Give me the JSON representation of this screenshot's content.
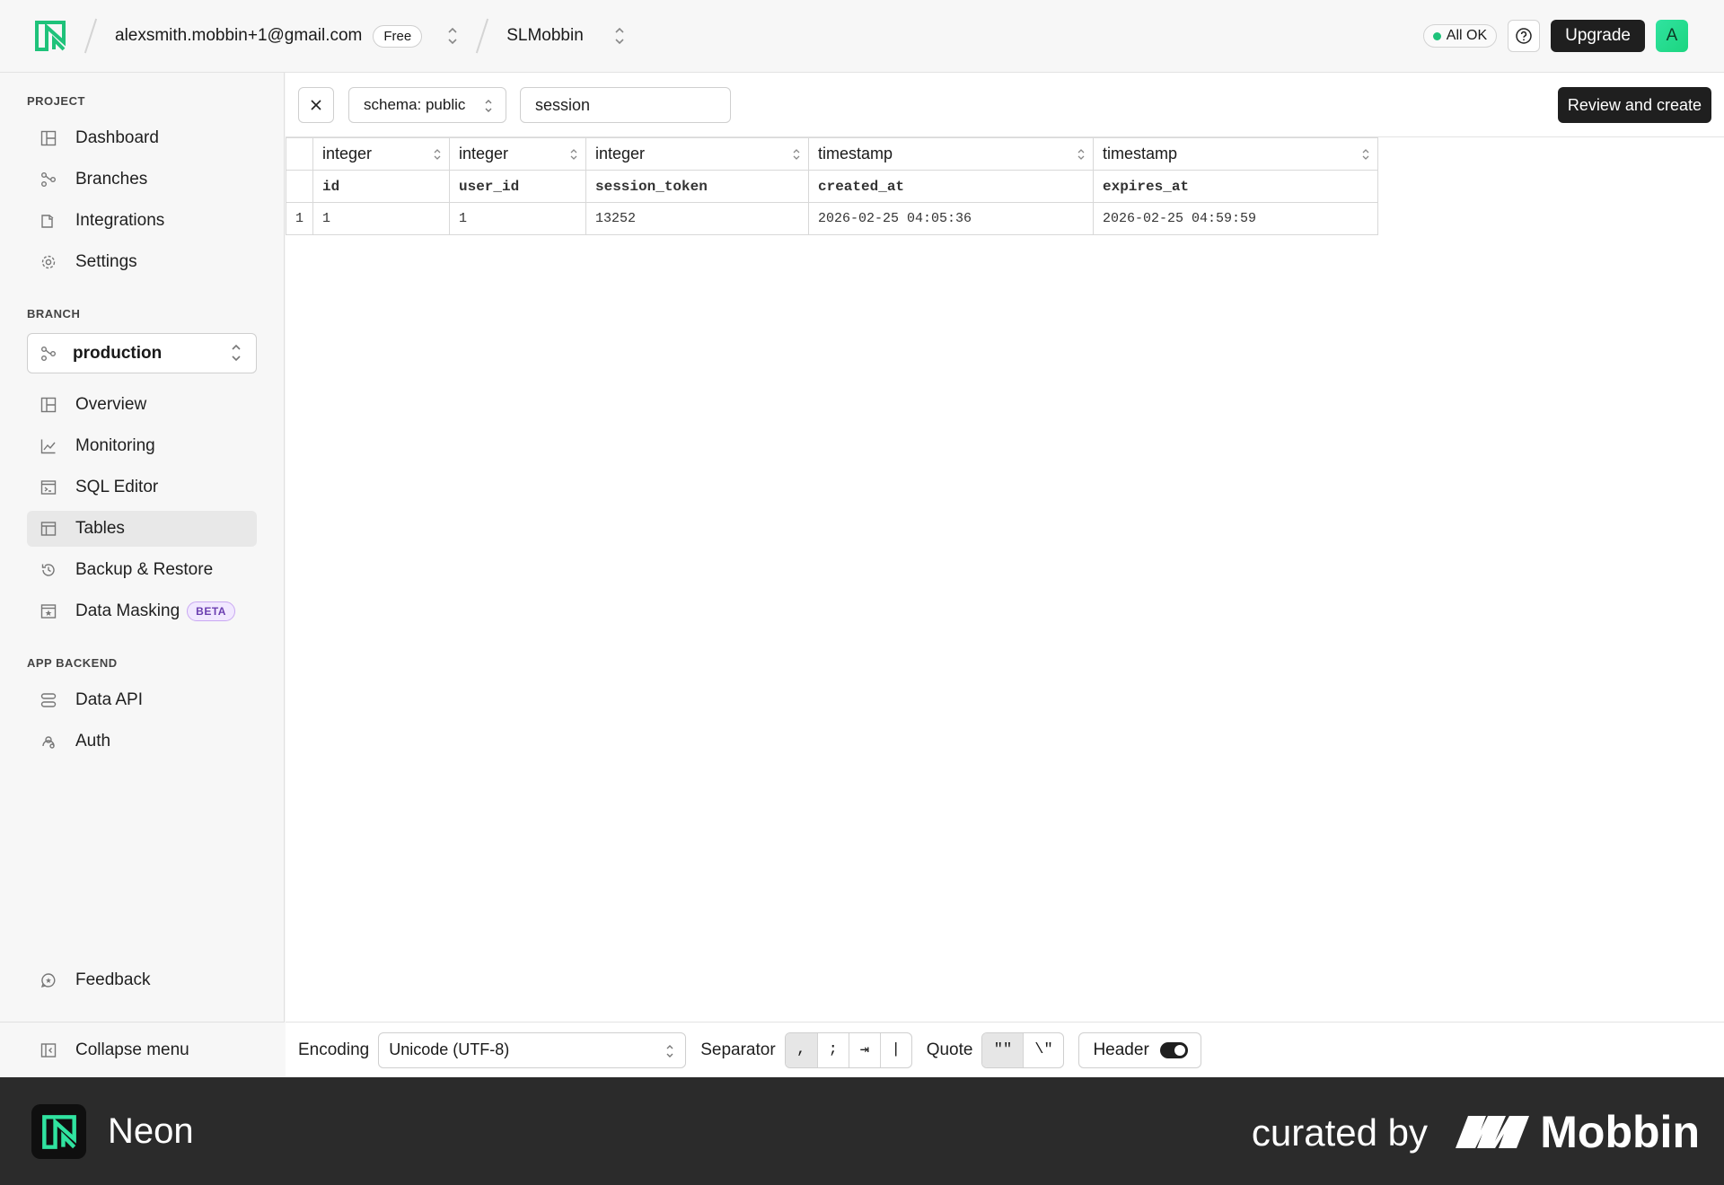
{
  "header": {
    "account": "alexsmith.mobbin+1@gmail.com",
    "plan_badge": "Free",
    "project": "SLMobbin",
    "status": "All OK",
    "upgrade_label": "Upgrade",
    "avatar_letter": "A"
  },
  "sidebar": {
    "project_title": "PROJECT",
    "project_items": [
      {
        "label": "Dashboard",
        "icon": "dashboard-icon"
      },
      {
        "label": "Branches",
        "icon": "branches-icon"
      },
      {
        "label": "Integrations",
        "icon": "integrations-icon"
      },
      {
        "label": "Settings",
        "icon": "gear-icon"
      }
    ],
    "branch_title": "BRANCH",
    "branch_selected": "production",
    "branch_items": [
      {
        "label": "Overview",
        "icon": "overview-icon"
      },
      {
        "label": "Monitoring",
        "icon": "chart-icon"
      },
      {
        "label": "SQL Editor",
        "icon": "terminal-icon"
      },
      {
        "label": "Tables",
        "icon": "table-icon",
        "active": true
      },
      {
        "label": "Backup & Restore",
        "icon": "history-icon"
      },
      {
        "label": "Data Masking",
        "icon": "mask-icon",
        "badge": "BETA"
      }
    ],
    "backend_title": "APP BACKEND",
    "backend_items": [
      {
        "label": "Data API",
        "icon": "api-icon"
      },
      {
        "label": "Auth",
        "icon": "auth-icon"
      }
    ],
    "feedback_label": "Feedback",
    "collapse_label": "Collapse menu"
  },
  "toolbar": {
    "schema_label": "schema: public",
    "table_name": "session",
    "review_label": "Review and create"
  },
  "table": {
    "types": [
      "integer",
      "integer",
      "integer",
      "timestamp",
      "timestamp"
    ],
    "columns": [
      "id",
      "user_id",
      "session_token",
      "created_at",
      "expires_at"
    ],
    "rows": [
      {
        "num": "1",
        "cells": [
          "1",
          "1",
          "13252",
          "2026-02-25 04:05:36",
          "2026-02-25 04:59:59"
        ]
      }
    ]
  },
  "footer": {
    "encoding_label": "Encoding",
    "encoding_value": "Unicode (UTF-8)",
    "separator_label": "Separator",
    "separators": [
      ",",
      ";",
      "⇥",
      "|"
    ],
    "quote_label": "Quote",
    "quotes": [
      "\"\"",
      "\\\""
    ],
    "header_label": "Header",
    "header_enabled": true
  },
  "brand": {
    "name": "Neon",
    "curated": "curated by",
    "mobbin": "Mobbin"
  },
  "colors": {
    "accent": "#1ec27a",
    "dark": "#1f1f1f",
    "beta": "#6b3fb0"
  }
}
